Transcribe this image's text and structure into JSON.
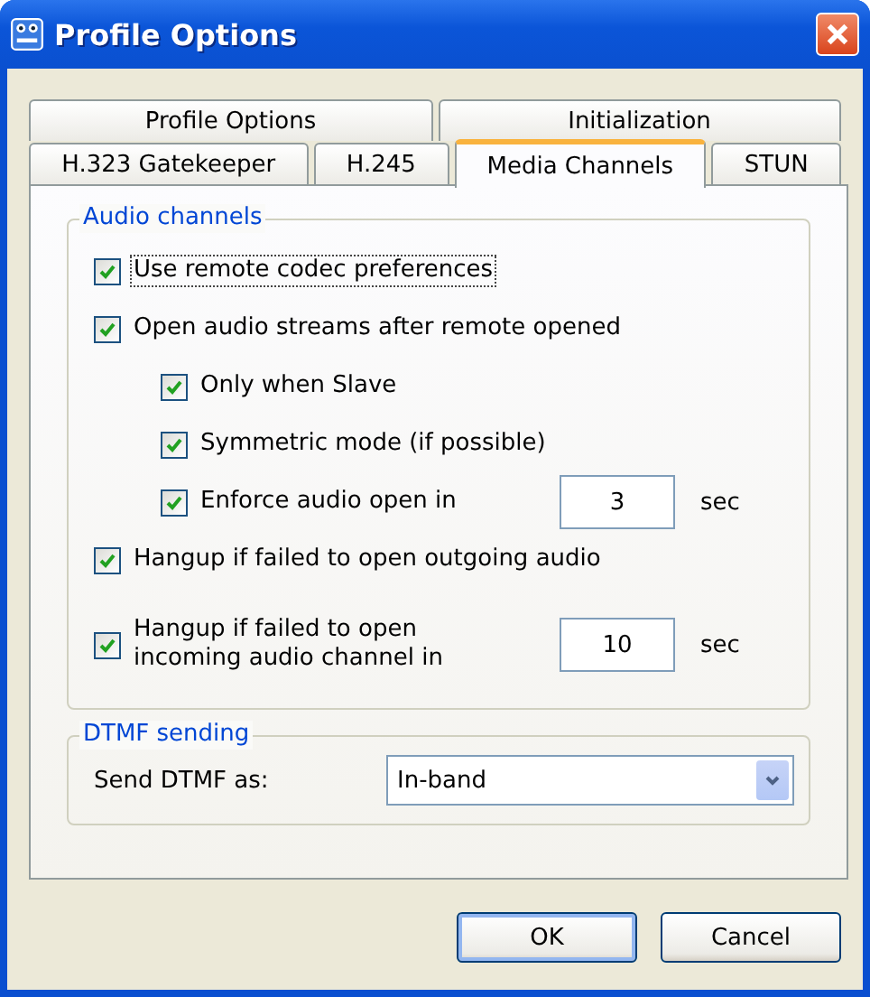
{
  "window": {
    "title": "Profile Options"
  },
  "tab_rows": [
    [
      {
        "label": "Profile Options",
        "selected": false
      },
      {
        "label": "Initialization",
        "selected": false
      }
    ],
    [
      {
        "label": "H.323 Gatekeeper",
        "selected": false
      },
      {
        "label": "H.245",
        "selected": false
      },
      {
        "label": "Media Channels",
        "selected": true
      },
      {
        "label": "STUN",
        "selected": false
      }
    ]
  ],
  "audio_group": {
    "title": "Audio channels",
    "options": [
      {
        "kind": "check",
        "label": "Use remote codec preferences",
        "checked": true,
        "focused": true
      },
      {
        "kind": "check",
        "label": "Open audio streams after remote opened",
        "checked": true,
        "focused": false,
        "children": [
          {
            "kind": "check",
            "label": "Only when Slave",
            "checked": true,
            "focused": false
          },
          {
            "kind": "check",
            "label": "Symmetric mode (if possible)",
            "checked": true,
            "focused": false
          },
          {
            "kind": "timeout",
            "label": "Enforce audio open in",
            "checked": true,
            "focused": false,
            "value": "3",
            "unit": "sec"
          }
        ]
      },
      {
        "kind": "check",
        "label": "Hangup if failed to open outgoing audio",
        "checked": true,
        "focused": false
      },
      {
        "kind": "timeout",
        "label": "Hangup if failed to open\nincoming audio channel in",
        "checked": true,
        "focused": false,
        "value": "10",
        "unit": "sec"
      }
    ]
  },
  "dtmf_group": {
    "title": "DTMF sending",
    "label": "Send DTMF as:",
    "value": "In-band"
  },
  "buttons": [
    {
      "label": "OK",
      "default": true
    },
    {
      "label": "Cancel",
      "default": false
    }
  ]
}
